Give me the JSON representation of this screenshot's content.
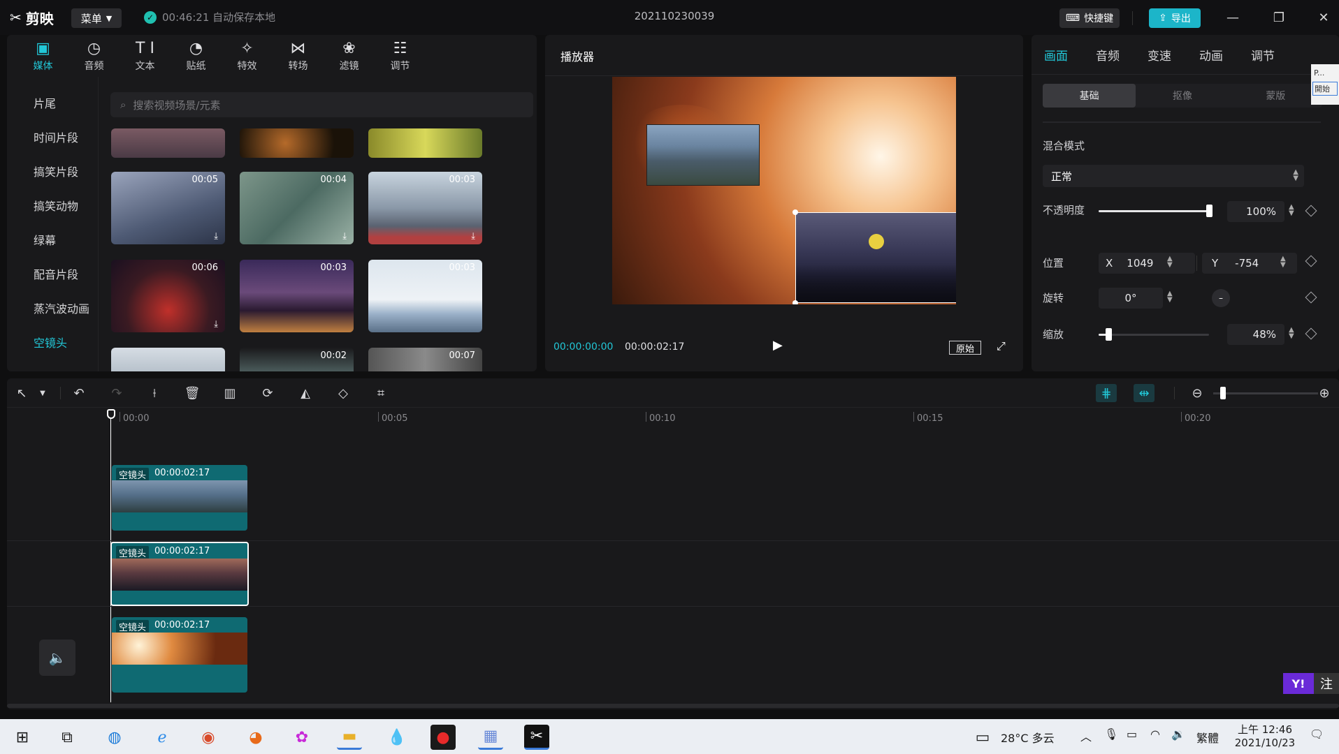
{
  "titlebar": {
    "app_name": "剪映",
    "menu_label": "菜单",
    "autosave_text": "00:46:21 自动保存本地",
    "project_name": "202110230039",
    "shortcut_label": "快捷键",
    "export_label": "导出"
  },
  "tool_tabs": [
    {
      "label": "媒体",
      "icon": "media-icon"
    },
    {
      "label": "音频",
      "icon": "audio-icon"
    },
    {
      "label": "文本",
      "icon": "text-icon"
    },
    {
      "label": "贴纸",
      "icon": "sticker-icon"
    },
    {
      "label": "特效",
      "icon": "effects-icon"
    },
    {
      "label": "转场",
      "icon": "transition-icon"
    },
    {
      "label": "滤镜",
      "icon": "filter-icon"
    },
    {
      "label": "调节",
      "icon": "adjust-icon"
    }
  ],
  "categories": [
    {
      "label": "片尾"
    },
    {
      "label": "时间片段"
    },
    {
      "label": "搞笑片段"
    },
    {
      "label": "搞笑动物"
    },
    {
      "label": "绿幕"
    },
    {
      "label": "配音片段"
    },
    {
      "label": "蒸汽波动画"
    },
    {
      "label": "空镜头"
    }
  ],
  "search": {
    "placeholder": "搜索视频场景/元素"
  },
  "thumbnails": [
    {
      "duration": "00:05"
    },
    {
      "duration": "00:04"
    },
    {
      "duration": "00:03"
    },
    {
      "duration": "00:06"
    },
    {
      "duration": "00:03"
    },
    {
      "duration": "00:03"
    },
    {
      "duration": "00:02"
    },
    {
      "duration": "00:07"
    }
  ],
  "player": {
    "title": "播放器",
    "current_time": "00:00:00:00",
    "total_time": "00:00:02:17",
    "original_label": "原始"
  },
  "props": {
    "tabs": [
      "画面",
      "音频",
      "变速",
      "动画",
      "调节"
    ],
    "subtabs": [
      "基础",
      "抠像",
      "蒙版"
    ],
    "blend_label": "混合模式",
    "blend_value": "正常",
    "opacity_label": "不透明度",
    "opacity_value": "100%",
    "opacity_level": 1.0,
    "position_label": "位置",
    "x_label": "X",
    "x_value": "1049",
    "y_label": "Y",
    "y_value": "-754",
    "rotate_label": "旋转",
    "rotate_value": "0°",
    "scale_label": "缩放",
    "scale_value": "48%",
    "scale_level": 0.08
  },
  "timeline": {
    "ruler": [
      "00:00",
      "00:05",
      "00:10",
      "00:15",
      "00:20"
    ],
    "clips": [
      {
        "tag": "空镜头",
        "duration": "00:00:02:17"
      },
      {
        "tag": "空镜头",
        "duration": "00:00:02:17"
      },
      {
        "tag": "空镜头",
        "duration": "00:00:02:17"
      }
    ]
  },
  "side_popup": {
    "text1": "P...",
    "text2": "開始"
  },
  "ime_badge": "注",
  "taskbar": {
    "weather": "28°C 多云",
    "ime": "繁體",
    "time": "上午 12:46",
    "date": "2021/10/23"
  },
  "colors": {
    "accent": "#22c7d7",
    "export": "#1cb5c9",
    "clip": "#0f6a72",
    "panel": "#19191b"
  }
}
